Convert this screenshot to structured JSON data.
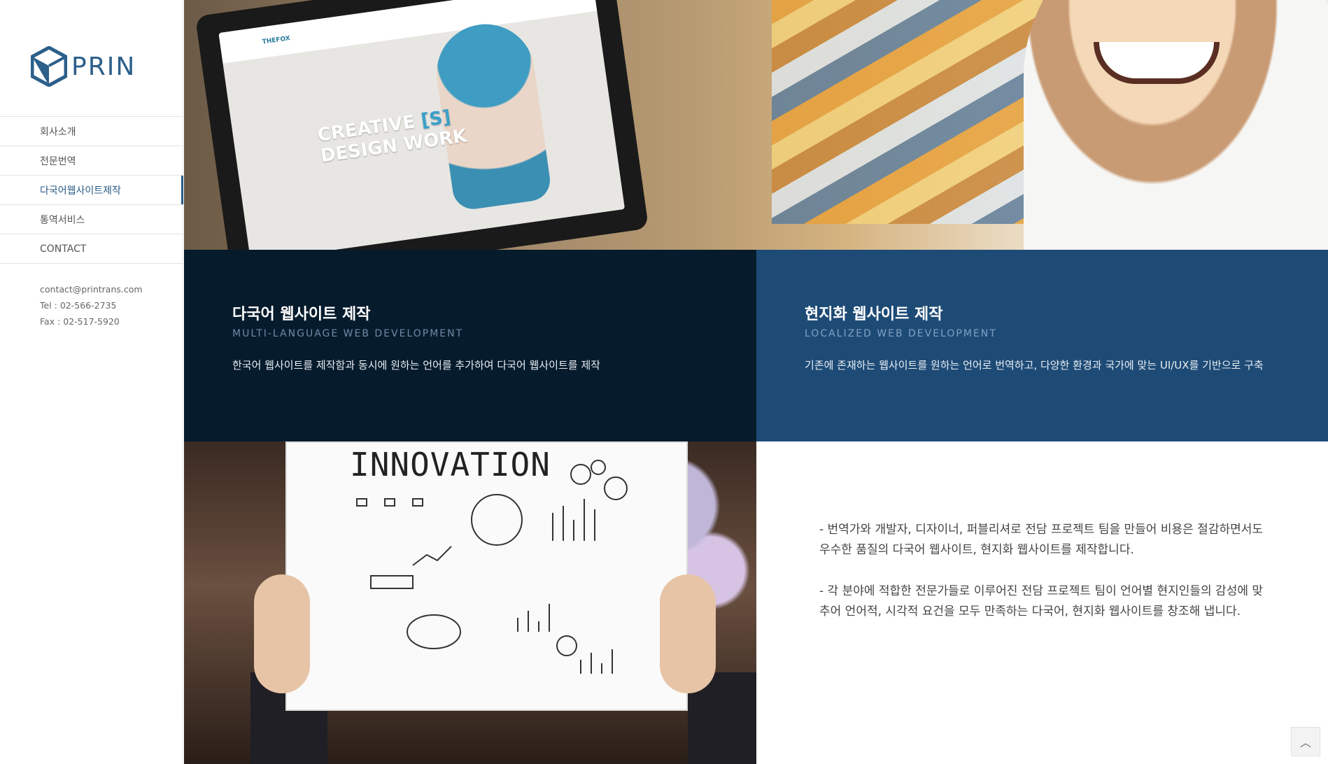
{
  "brand": {
    "name": "PRIN"
  },
  "nav": [
    {
      "label": "회사소개",
      "active": false
    },
    {
      "label": "전문번역",
      "active": false
    },
    {
      "label": "다국어웹사이트제작",
      "active": true
    },
    {
      "label": "통역서비스",
      "active": false
    },
    {
      "label": "CONTACT",
      "active": false
    }
  ],
  "contact": {
    "email": "contact@printrans.com",
    "tel": "Tel : 02-566-2735",
    "fax": "Fax : 02-517-5920"
  },
  "hero": {
    "laptop_brand": "THEFOX",
    "laptop_headline_1": "CREATIVE",
    "laptop_headline_accent": "[S]",
    "laptop_headline_2": "DESIGN WORK"
  },
  "blocks": [
    {
      "title": "다국어 웹사이트 제작",
      "subtitle": "MULTI-LANGUAGE WEB DEVELOPMENT",
      "description": "한국어 웹사이트를 제작함과 동시에 원하는 언어를 추가하여 다국어 웹사이트를 제작"
    },
    {
      "title": "현지화 웹사이트 제작",
      "subtitle": "LOCALIZED WEB DEVELOPMENT",
      "description": "기존에 존재하는 웹사이트를 원하는 언어로 번역하고, 다양한 환경과 국가에 맞는 UI/UX를 기반으로 구축"
    }
  ],
  "innovation": {
    "board_title": "INNOVATION"
  },
  "features": [
    "- 번역가와 개발자, 디자이너, 퍼블리셔로 전담 프로젝트 팀을 만들어 비용은 절감하면서도 우수한 품질의 다국어 웹사이트, 현지화 웹사이트를 제작합니다.",
    "- 각 분야에 적합한 전문가들로 이루어진 전담 프로젝트 팀이 언어별 현지인들의 감성에 맞추어 언어적, 시각적 요건을 모두 만족하는 다국어, 현지화 웹사이트를 창조해 냅니다."
  ],
  "scroll_top": {
    "icon": "chevron-up-icon"
  },
  "colors": {
    "brand": "#2c5f8a",
    "dark_block": "#061b2c",
    "blue_block": "#1e4b76"
  }
}
